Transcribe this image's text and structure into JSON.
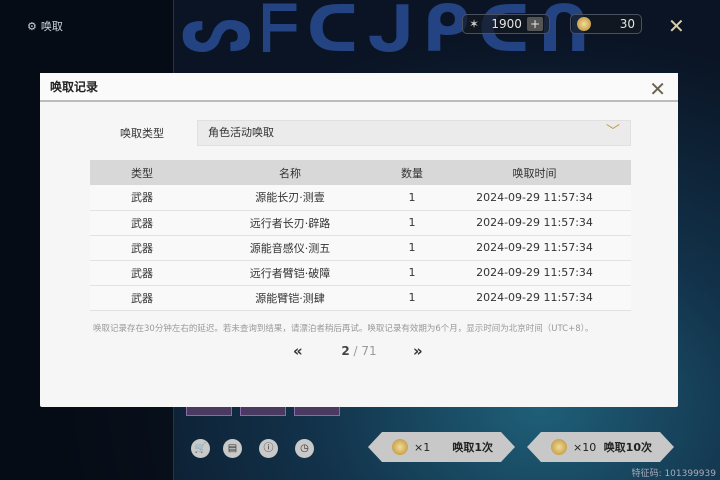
{
  "nav": {
    "title": "唤取"
  },
  "currency": {
    "astrite": "1900",
    "plus": "+",
    "tide": "30"
  },
  "modal": {
    "title": "唤取记录",
    "type_label": "唤取类型",
    "type_value": "角色活动唤取",
    "columns": [
      "类型",
      "名称",
      "数量",
      "唤取时间"
    ],
    "rows": [
      [
        "武器",
        "源能长刃·测壹",
        "1",
        "2024-09-29 11:57:34"
      ],
      [
        "武器",
        "远行者长刃·辟路",
        "1",
        "2024-09-29 11:57:34"
      ],
      [
        "武器",
        "源能音感仪·测五",
        "1",
        "2024-09-29 11:57:34"
      ],
      [
        "武器",
        "远行者臂铠·破障",
        "1",
        "2024-09-29 11:57:34"
      ],
      [
        "武器",
        "源能臂铠·测肆",
        "1",
        "2024-09-29 11:57:34"
      ]
    ],
    "note": "唤取记录存在30分钟左右的延迟。若未查询到结果，请漂泊者稍后再试。唤取记录有效期为6个月，显示时间为北京时间（UTC+8）。",
    "page": {
      "current": "2",
      "total": "/ 71",
      "prev": "«",
      "next": "»"
    }
  },
  "pull": {
    "one_count": "×1",
    "one_label": "唤取1次",
    "ten_count": "×10",
    "ten_label": "唤取10次"
  },
  "feature_code": "特征码: 101399939"
}
